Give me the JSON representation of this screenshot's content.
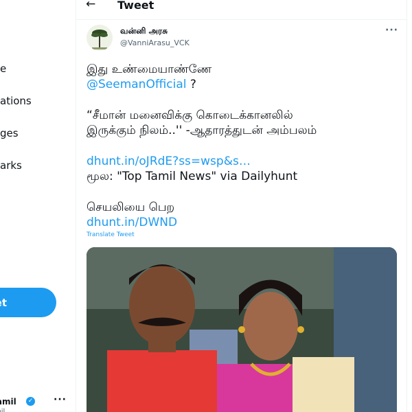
{
  "sidebar": {
    "items": [
      {
        "label": "e"
      },
      {
        "label": "ations"
      },
      {
        "label": "ges"
      },
      {
        "label": "arks"
      }
    ],
    "tweet_button": "et",
    "account": {
      "name": "a Tamil",
      "handle": "mil"
    }
  },
  "header": {
    "title": "Tweet"
  },
  "tweet": {
    "author_name": "வன்னி அரசு",
    "author_handle": "@VanniArasu_VCK",
    "line1": "இது உண்மையாண்ணே",
    "mention": "@SeemanOfficial",
    "mention_suffix": " ?",
    "quote_line1": "“சீமான் மனைவிக்கு கொடைக்கானலில்",
    "quote_line2": "இருக்கும் நிலம்..'' -ஆதாரத்துடன் அம்பலம்",
    "link1": "dhunt.in/oJRdE?ss=wsp&s…",
    "source_line": "மூல: \"Top Tamil News\" via Dailyhunt",
    "app_line": "செயலியை பெற",
    "link2": "dhunt.in/DWND",
    "translate": "Translate Tweet"
  },
  "colors": {
    "accent": "#1d9bf0",
    "text": "#0f1419",
    "secondary": "#536471"
  },
  "icons": [
    "back-arrow-icon",
    "more-icon",
    "verified-icon"
  ]
}
